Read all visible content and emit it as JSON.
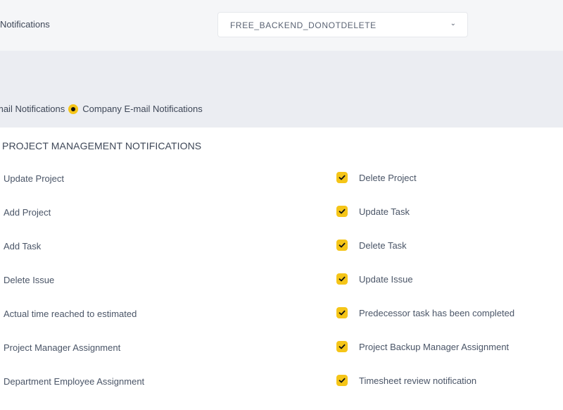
{
  "header": {
    "title": "Notifications",
    "company_select": {
      "value": "FREE_BACKEND_DONOTDELETE",
      "icon": "chevron-down-icon"
    }
  },
  "notification_scope": {
    "option_personal": "mail Notifications",
    "option_company": "Company E-mail Notifications",
    "selected": "option_company",
    "accent_color": "#f5c518"
  },
  "section": {
    "title": "PROJECT MANAGEMENT NOTIFICATIONS",
    "left_items": [
      "Update Project",
      "Add Project",
      "Add Task",
      "Delete Issue",
      "Actual time reached to estimated",
      "Project Manager Assignment",
      "Department Employee Assignment"
    ],
    "right_items": [
      {
        "label": "Delete Project",
        "checked": true
      },
      {
        "label": "Update Task",
        "checked": true
      },
      {
        "label": "Delete Task",
        "checked": true
      },
      {
        "label": "Update Issue",
        "checked": true
      },
      {
        "label": "Predecessor task has been completed",
        "checked": true
      },
      {
        "label": "Project Backup Manager Assignment",
        "checked": true
      },
      {
        "label": "Timesheet review notification",
        "checked": true
      }
    ]
  }
}
